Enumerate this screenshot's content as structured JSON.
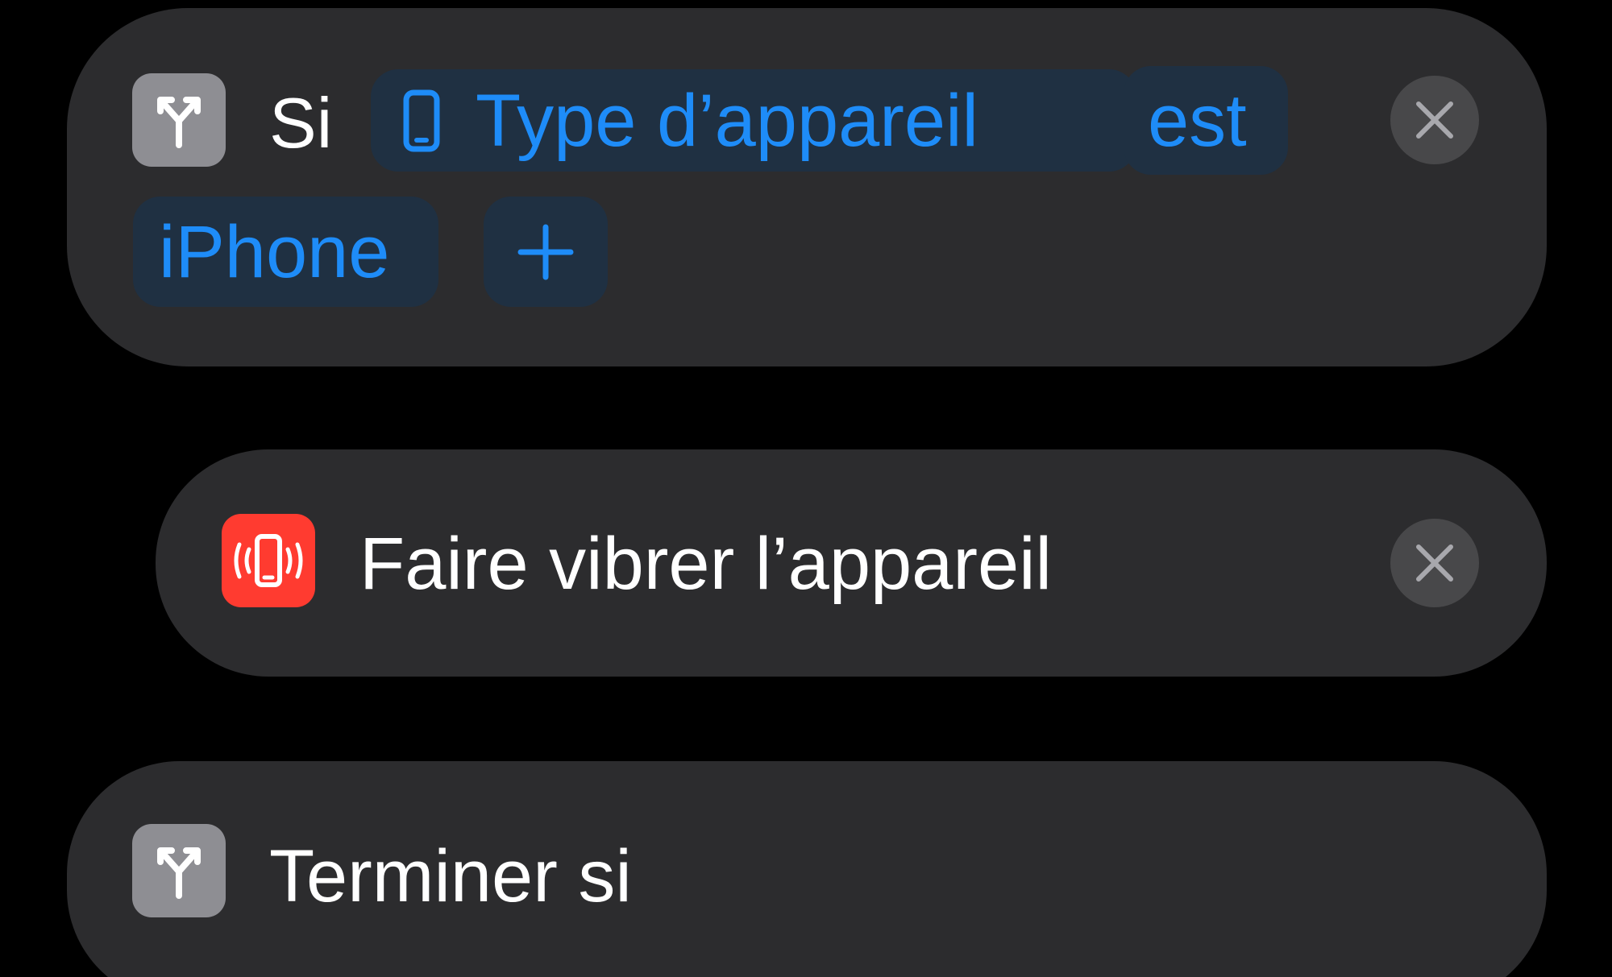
{
  "if_block": {
    "keyword": "Si",
    "icon": "branch-icon",
    "parameter": {
      "label": "Type d’appareil",
      "icon": "iphone-icon"
    },
    "operator": "est",
    "value": "iPhone",
    "add_icon": "plus-icon",
    "close_icon": "close-icon"
  },
  "vibrate_block": {
    "label": "Faire vibrer l’appareil",
    "icon": "vibrate-device-icon",
    "close_icon": "close-icon"
  },
  "endif_block": {
    "label": "Terminer si",
    "icon": "branch-icon"
  },
  "colors": {
    "background": "#000000",
    "card": "#2c2c2e",
    "accent_blue": "#1e8cf8",
    "pill": "#1f3042",
    "icon_gray": "#8e8e93",
    "icon_red": "#ff3b30",
    "close_button": "#48484a"
  }
}
